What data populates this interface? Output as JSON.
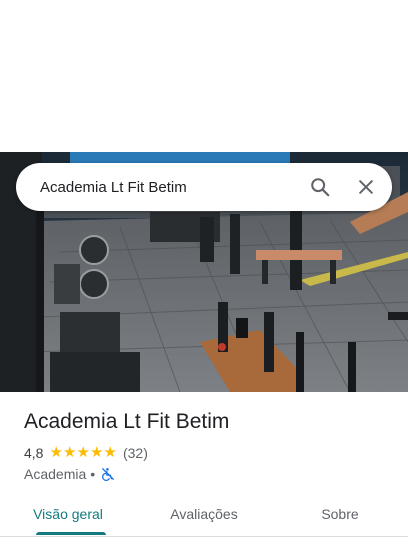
{
  "search": {
    "query": "Academia Lt Fit Betim"
  },
  "place": {
    "name": "Academia Lt Fit Betim",
    "rating": "4,8",
    "stars": 5,
    "star_glyph": "★",
    "review_count": "(32)",
    "category": "Academia",
    "separator": "•",
    "category_icon": "no-wheelchair-access-icon"
  },
  "tabs": [
    {
      "label": "Visão geral",
      "active": true
    },
    {
      "label": "Avaliações",
      "active": false
    },
    {
      "label": "Sobre",
      "active": false
    }
  ],
  "colors": {
    "accent": "#137a7f",
    "star": "#fbbc04",
    "accessibility_icon": "#1a73e8",
    "text_primary": "#202124",
    "text_secondary": "#5f6368"
  }
}
